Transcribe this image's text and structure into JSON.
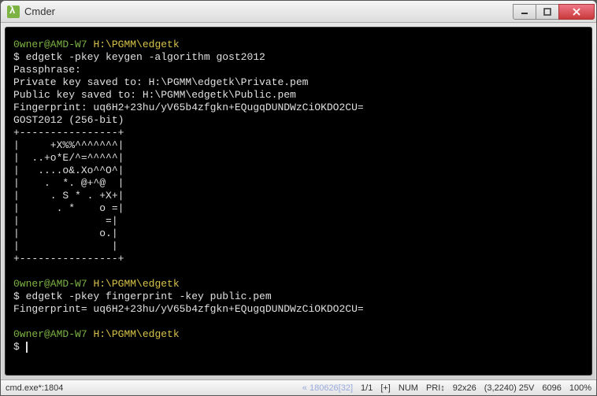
{
  "window": {
    "title": "Cmder",
    "icon": "lambda-icon"
  },
  "colors": {
    "prompt_user": "#7cb342",
    "prompt_path": "#d6c24a",
    "terminal_bg": "#000000",
    "terminal_fg": "#e0e0e0"
  },
  "session": {
    "user_host": "0wner@AMD-W7",
    "path": "H:\\PGMM\\edgetk",
    "prompt_symbol": "$"
  },
  "blocks": [
    {
      "command": "edgetk -pkey keygen -algorithm gost2012",
      "output": [
        "Passphrase:",
        "Private key saved to: H:\\PGMM\\edgetk\\Private.pem",
        "Public key saved to: H:\\PGMM\\edgetk\\Public.pem",
        "Fingerprint: uq6H2+23hu/yV65b4zfgkn+EQugqDUNDWzCiOKDO2CU=",
        "GOST2012 (256-bit)",
        "+----------------+",
        "|     +X%%^^^^^^^|",
        "|  ..+o*E/^=^^^^^|",
        "|   ....o&.Xo^^O^|",
        "|    .  *. @+^@  |",
        "|     . S * . +X+|",
        "|      . *    o =|",
        "|              =|",
        "|             o.|",
        "|               |",
        "+----------------+",
        ""
      ]
    },
    {
      "command": "edgetk -pkey fingerprint -key public.pem",
      "output": [
        "Fingerprint= uq6H2+23hu/yV65b4zfgkn+EQugqDUNDWzCiOKDO2CU=",
        ""
      ]
    }
  ],
  "statusbar": {
    "tab": "cmd.exe*:1804",
    "info": "« 180626[32]",
    "pos": "1/1",
    "plus": "[+]",
    "num": "NUM",
    "pri": "PRI↕",
    "size": "92x26",
    "cursor": "(3,2240) 25V",
    "perf1": "6096",
    "perf2": "100%"
  }
}
